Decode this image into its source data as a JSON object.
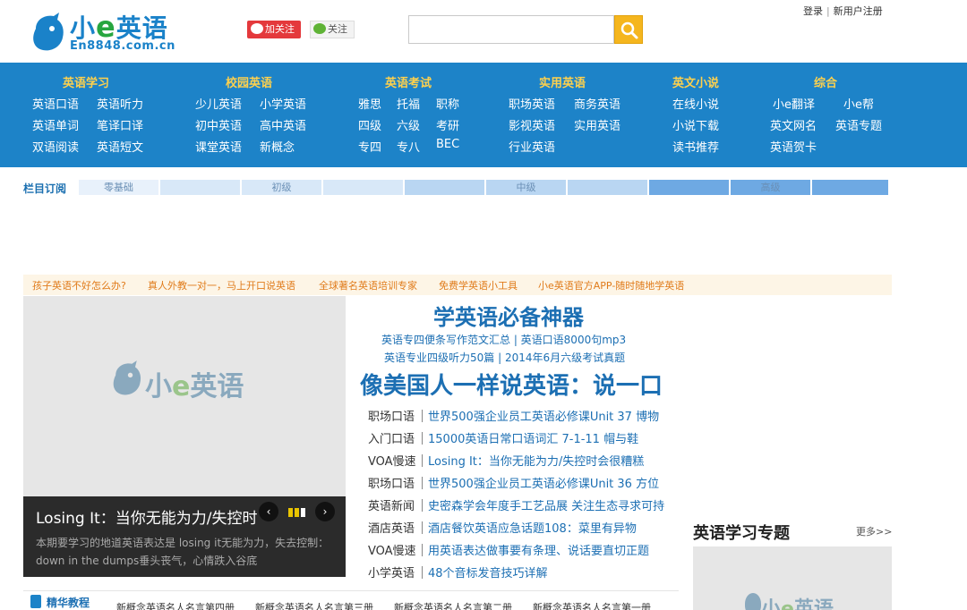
{
  "header": {
    "logo_text_1": "小",
    "logo_text_e": "e",
    "logo_text_2": "英语",
    "logo_domain": "En8848.com.cn",
    "weibo_label": "加关注",
    "wechat_label": "关注",
    "search_placeholder": "",
    "login": "登录",
    "register": "新用户注册"
  },
  "nav": {
    "columns": [
      {
        "head": "英语学习",
        "links": [
          "英语口语",
          "英语听力",
          "英语单词",
          "笔译口译",
          "双语阅读",
          "英语短文"
        ]
      },
      {
        "head": "校园英语",
        "links": [
          "少儿英语",
          "小学英语",
          "初中英语",
          "高中英语",
          "课堂英语",
          "新概念"
        ]
      },
      {
        "head": "英语考试",
        "links": [
          "雅思",
          "托福",
          "职称",
          "四级",
          "六级",
          "考研",
          "专四",
          "专八",
          "BEC"
        ]
      },
      {
        "head": "实用英语",
        "links": [
          "职场英语",
          "商务英语",
          "影视英语",
          "实用英语",
          "行业英语"
        ]
      },
      {
        "head": "英文小说",
        "links": [
          "在线小说",
          "小说下载",
          "读书推荐"
        ]
      },
      {
        "head": "综合",
        "links": [
          "小e翻译",
          "小e帮",
          "英文网名",
          "英语专题",
          "英语贺卡"
        ]
      }
    ]
  },
  "subscribe": {
    "label": "栏目订阅",
    "cells": [
      "零基础",
      "",
      "初级",
      "",
      "",
      "中级",
      "",
      "",
      "高级",
      ""
    ]
  },
  "promo": [
    "孩子英语不好怎么办?",
    "真人外教一对一，马上开口说英语",
    "全球著名英语培训专家",
    "免费学英语小工具",
    "小e英语官方APP-随时随地学英语"
  ],
  "slider": {
    "logo_1": "小",
    "logo_e": "e",
    "logo_2": "英语",
    "caption_title": "Losing It：当你无能为力/失控时",
    "caption_desc": "本期要学习的地道英语表达是 losing it无能为力，失去控制：down in the dumps垂头丧气，心情跌入谷底",
    "prev": "‹",
    "next": "›"
  },
  "mid": {
    "title1": "学英语必备神器",
    "line1": "英语专四便条写作范文汇总 | 英语口语8000句mp3",
    "line2": "英语专业四级听力50篇 | 2014年6月六级考试真题",
    "title2": "像美国人一样说英语：说一口",
    "list": [
      {
        "cat": "职场口语",
        "txt": "世界500强企业员工英语必修课Unit 37 博物"
      },
      {
        "cat": "入门口语",
        "txt": "15000英语日常口语词汇 7-1-11 帽与鞋"
      },
      {
        "cat": "VOA慢速",
        "txt": "Losing It：当你无能为力/失控时会很糟糕"
      },
      {
        "cat": "职场口语",
        "txt": "世界500强企业员工英语必修课Unit 36 方位"
      },
      {
        "cat": "英语新闻",
        "txt": "史密森学会年度手工艺品展 关注生态寻求可持"
      },
      {
        "cat": "酒店英语",
        "txt": "酒店餐饮英语应急话题108：菜里有异物"
      },
      {
        "cat": "VOA慢速",
        "txt": "用英语表达做事要有条理、说话要直切正题"
      },
      {
        "cat": "小学英语",
        "txt": "48个音标发音技巧详解"
      }
    ]
  },
  "special": {
    "title": "英语学习专题",
    "more": "更多>>",
    "logo_1": "小",
    "logo_e": "e",
    "logo_2": "英语"
  },
  "tutorials": {
    "label": "精华教程",
    "items": [
      "新概念英语名人名言第四册",
      "新概念英语名人名言第三册",
      "新概念英语名人名言第二册",
      "新概念英语名人名言第一册"
    ]
  },
  "colors": {
    "nav_bg": "#1d83c8",
    "nav_head": "#ffd14d",
    "link_blue": "#1c6fb3",
    "promo_orange": "#e07b1a",
    "search_btn": "#f5b61e"
  }
}
